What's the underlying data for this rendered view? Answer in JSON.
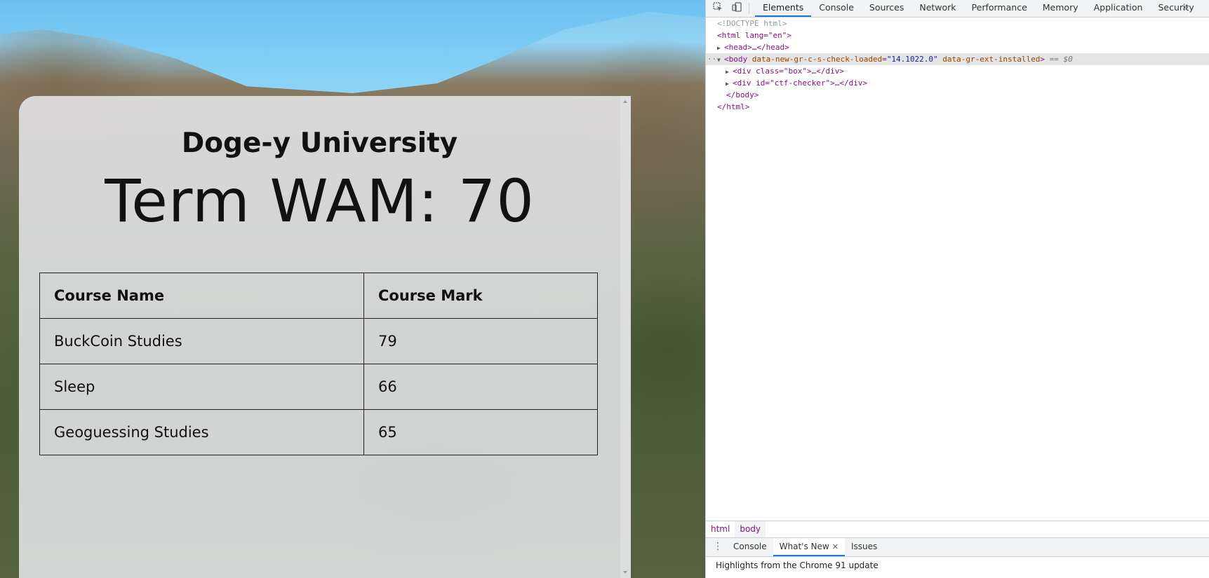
{
  "page": {
    "university": "Doge-y University",
    "wam": "Term WAM: 70",
    "table": {
      "headers": [
        "Course Name",
        "Course Mark"
      ],
      "rows": [
        [
          "BuckCoin Studies",
          "79"
        ],
        [
          "Sleep",
          "66"
        ],
        [
          "Geoguessing Studies",
          "65"
        ]
      ]
    }
  },
  "devtools": {
    "tabs": [
      "Elements",
      "Console",
      "Sources",
      "Network",
      "Performance",
      "Memory",
      "Application",
      "Security"
    ],
    "active_tab": "Elements",
    "overflow": "»",
    "dom": {
      "doctype": "<!DOCTYPE html>",
      "html_open": "<html lang=\"en\">",
      "head": "<head>…</head>",
      "body_tag": "<body",
      "body_attr1_name": "data-new-gr-c-s-check-loaded",
      "body_attr1_val": "\"14.1022.0\"",
      "body_attr2_name": "data-gr-ext-installed",
      "body_close_bracket": ">",
      "body_eq": "== $0",
      "div_box": "<div class=\"box\">…</div>",
      "div_ctf": "<div id=\"ctf-checker\">…</div>",
      "body_close": "</body>",
      "html_close": "</html>"
    },
    "breadcrumbs": [
      "html",
      "body"
    ],
    "drawer": {
      "tabs": [
        "Console",
        "What's New",
        "Issues"
      ],
      "active": "What's New",
      "content": "Highlights from the Chrome 91 update"
    }
  }
}
